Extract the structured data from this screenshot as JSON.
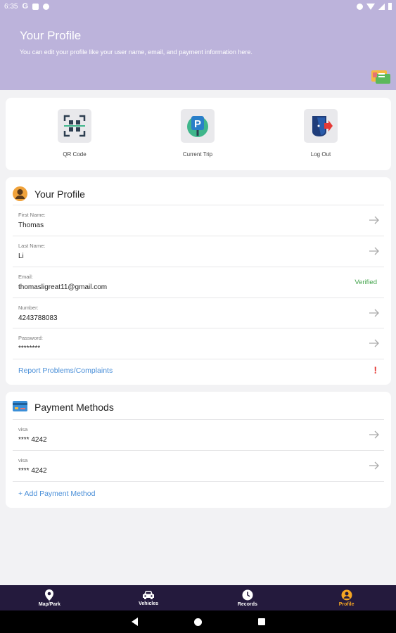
{
  "status_bar": {
    "time": "6:35",
    "g_glyph": "G"
  },
  "header": {
    "title": "Your Profile",
    "subtitle": "You can edit your profile like your user name, email, and payment information here."
  },
  "quick_actions": [
    {
      "label": "QR Code",
      "icon": "qr-code-icon"
    },
    {
      "label": "Current Trip",
      "icon": "parking-icon"
    },
    {
      "label": "Log Out",
      "icon": "logout-icon"
    }
  ],
  "profile": {
    "title": "Your Profile",
    "fields": {
      "first_name": {
        "key": "First Name:",
        "value": "Thomas"
      },
      "last_name": {
        "key": "Last Name:",
        "value": "Li"
      },
      "email": {
        "key": "Email:",
        "value": "thomasligreat11@gmail.com",
        "status": "Verified"
      },
      "number": {
        "key": "Number:",
        "value": "4243788083"
      },
      "password": {
        "key": "Password:",
        "value": "********"
      }
    },
    "report_link": "Report Problems/Complaints",
    "report_mark": "!"
  },
  "payment": {
    "title": "Payment Methods",
    "cards": [
      {
        "brand": "visa",
        "number": "**** 4242"
      },
      {
        "brand": "visa",
        "number": "**** 4242"
      }
    ],
    "add_link": "+ Add Payment Method"
  },
  "bottom_nav": [
    {
      "label": "Map/Park",
      "icon": "map-pin-icon"
    },
    {
      "label": "Vehicles",
      "icon": "car-icon"
    },
    {
      "label": "Records",
      "icon": "clock-icon"
    },
    {
      "label": "Profile",
      "icon": "person-icon"
    }
  ],
  "colors": {
    "header_bg": "#bcb3db",
    "nav_bg": "#241a3d",
    "active": "#f5a623",
    "link": "#4a8fd8",
    "verified": "#41a34a",
    "alert": "#e53935"
  }
}
